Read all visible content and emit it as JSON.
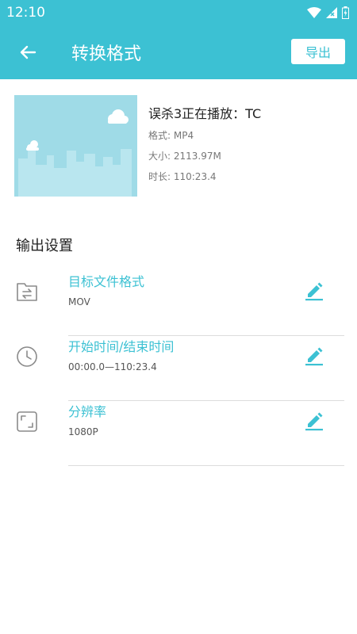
{
  "status": {
    "time": "12:10"
  },
  "header": {
    "title": "转换格式",
    "export_label": "导出"
  },
  "video": {
    "title": "误杀3正在播放：TC",
    "format": "格式: MP4",
    "size": "大小: 2113.97M",
    "duration": "时长: 110:23.4"
  },
  "settings": {
    "section_title": "输出设置",
    "items": [
      {
        "label": "目标文件格式",
        "value": "MOV",
        "icon": "folder-convert-icon"
      },
      {
        "label": "开始时间/结束时间",
        "value": "00:00.0—110:23.4",
        "icon": "clock-icon"
      },
      {
        "label": "分辨率",
        "value": "1080P",
        "icon": "resize-icon"
      }
    ]
  },
  "colors": {
    "accent": "#3cc1d3",
    "thumbnail_bg": "#9fdbe7"
  }
}
